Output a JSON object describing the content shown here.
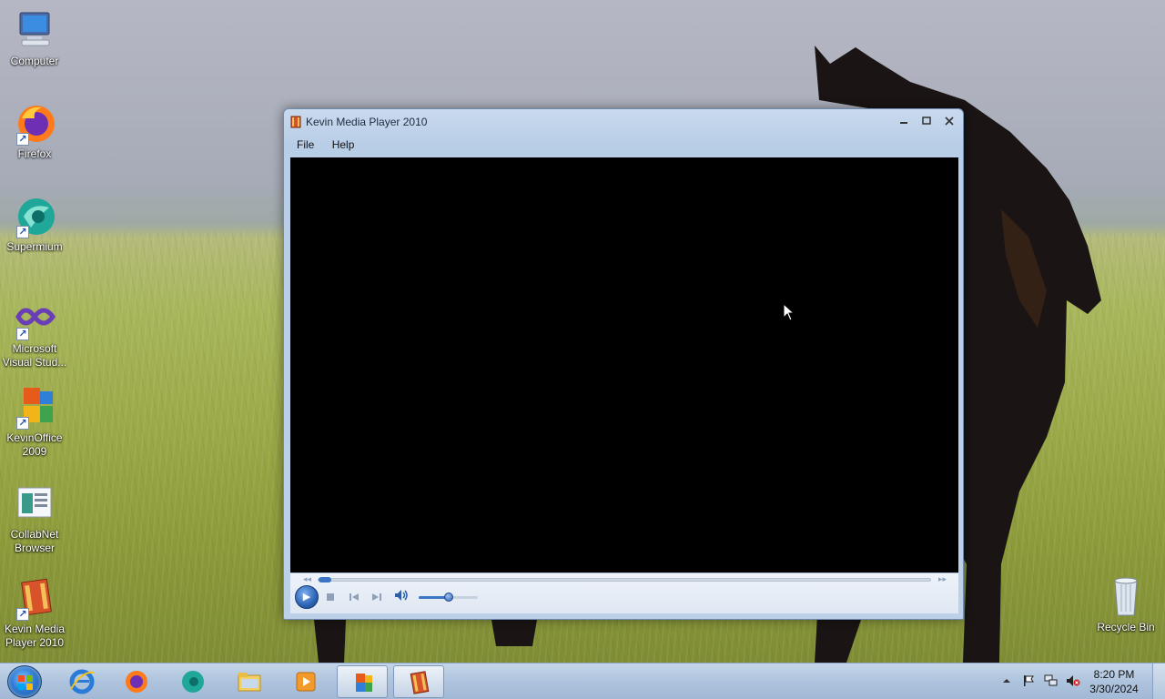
{
  "desktop": {
    "icons": [
      {
        "label": "Computer"
      },
      {
        "label": "Firefox"
      },
      {
        "label": "Supermium"
      },
      {
        "label": "Microsoft Visual Stud..."
      },
      {
        "label": "KevinOffice 2009"
      },
      {
        "label": "CollabNet Browser"
      },
      {
        "label": "Kevin Media Player 2010"
      },
      {
        "label": "Recycle Bin"
      }
    ]
  },
  "window": {
    "title": "Kevin Media Player 2010",
    "menu": [
      {
        "label": "File"
      },
      {
        "label": "Help"
      }
    ],
    "controls": {
      "seek_progress": 0.0,
      "volume_level": 0.5
    }
  },
  "taskbar": {
    "clock_time": "8:20 PM",
    "clock_date": "3/30/2024"
  },
  "colors": {
    "accent": "#3a74c2",
    "video_bg": "#000000"
  }
}
